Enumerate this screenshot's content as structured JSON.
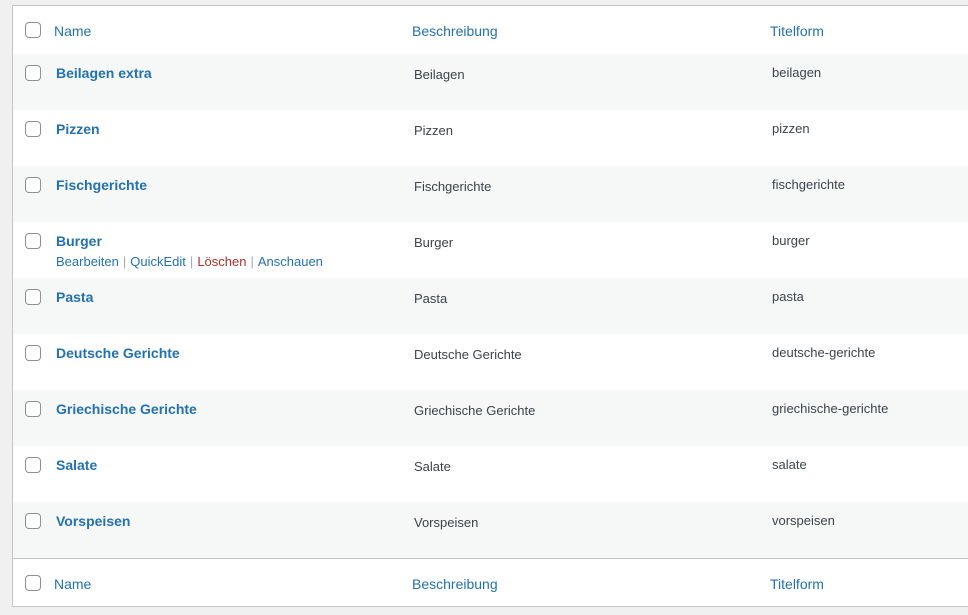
{
  "columns": {
    "name": "Name",
    "description": "Beschreibung",
    "slug": "Titelform"
  },
  "rows": [
    {
      "name": "Beilagen extra",
      "description": "Beilagen",
      "slug": "beilagen"
    },
    {
      "name": "Pizzen",
      "description": "Pizzen",
      "slug": "pizzen"
    },
    {
      "name": "Fischgerichte",
      "description": "Fischgerichte",
      "slug": "fischgerichte"
    },
    {
      "name": "Burger",
      "description": "Burger",
      "slug": "burger"
    },
    {
      "name": "Pasta",
      "description": "Pasta",
      "slug": "pasta"
    },
    {
      "name": "Deutsche Gerichte",
      "description": "Deutsche Gerichte",
      "slug": "deutsche-gerichte"
    },
    {
      "name": "Griechische Gerichte",
      "description": "Griechische Gerichte",
      "slug": "griechische-gerichte"
    },
    {
      "name": "Salate",
      "description": "Salate",
      "slug": "salate"
    },
    {
      "name": "Vorspeisen",
      "description": "Vorspeisen",
      "slug": "vorspeisen"
    }
  ],
  "row_actions": {
    "edit": "Bearbeiten",
    "quick_edit": "QuickEdit",
    "delete": "Löschen",
    "view": "Anschauen",
    "separator": "|"
  },
  "colors": {
    "link": "#2271b1",
    "delete": "#b32d2e",
    "text": "#3c434a",
    "row_alt": "#f6f7f7",
    "border": "#c3c4c7"
  }
}
